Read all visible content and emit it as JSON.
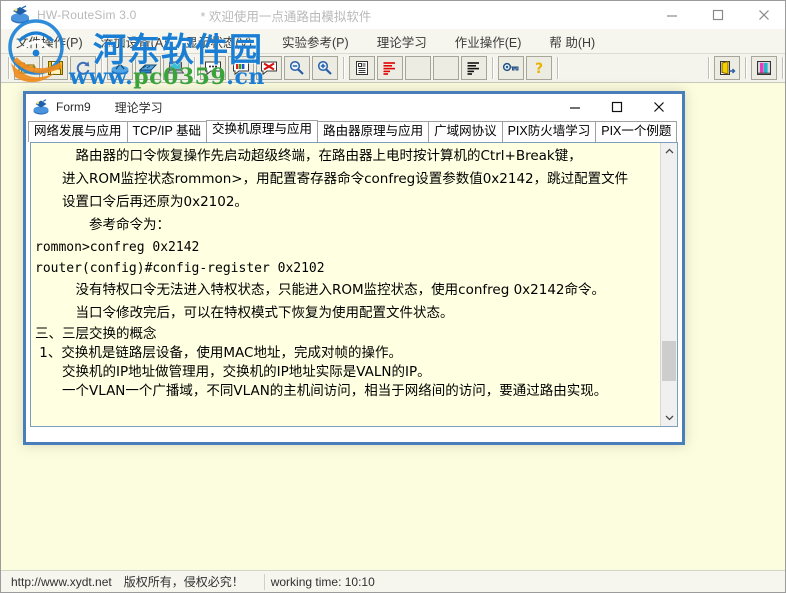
{
  "window": {
    "app_name": "HW-RouteSim 3.0",
    "title_note": "* 欢迎使用一点通路由模拟软件",
    "app_icon": "router-app-icon",
    "minimize": "minimize-icon",
    "maximize": "maximize-icon",
    "close": "close-icon"
  },
  "menubar": {
    "items": [
      {
        "label": "文件操作(P)",
        "name": "menu-file"
      },
      {
        "label": "添加设备(A)",
        "name": "menu-add-device"
      },
      {
        "label": "显示状态(V)",
        "name": "menu-show-status"
      },
      {
        "label": "实验参考(P)",
        "name": "menu-experiment-reference"
      },
      {
        "label": "理论学习",
        "name": "menu-theory-study"
      },
      {
        "label": "作业操作(E)",
        "name": "menu-homework"
      },
      {
        "label": "帮 助(H)",
        "name": "menu-help"
      }
    ]
  },
  "toolbar": {
    "buttons": [
      {
        "icon": "open-folder-icon",
        "name": "toolbar-open"
      },
      {
        "icon": "save-floppy-icon",
        "name": "toolbar-save"
      },
      {
        "icon": "refresh-icon",
        "name": "toolbar-refresh"
      },
      {
        "icon": "router-icon",
        "name": "toolbar-add-router"
      },
      {
        "icon": "switch-icon",
        "name": "toolbar-add-switch"
      },
      {
        "icon": "pc-icon",
        "name": "toolbar-add-pc"
      },
      {
        "icon": "console-balloon-icon",
        "name": "toolbar-console"
      },
      {
        "icon": "color-balloon-icon",
        "name": "toolbar-color-console"
      },
      {
        "icon": "close-balloon-icon",
        "name": "toolbar-close-console"
      },
      {
        "icon": "zoom-out-icon",
        "name": "toolbar-zoom-out"
      },
      {
        "icon": "zoom-in-icon",
        "name": "toolbar-zoom-in"
      },
      {
        "icon": "document-icon",
        "name": "toolbar-document"
      },
      {
        "icon": "red-lines-icon",
        "name": "toolbar-red-lines"
      },
      {
        "icon": "blank-icon",
        "name": "toolbar-blank-1"
      },
      {
        "icon": "blank-icon",
        "name": "toolbar-blank-2"
      },
      {
        "icon": "black-lines-icon",
        "name": "toolbar-black-lines"
      },
      {
        "icon": "key-icon",
        "name": "toolbar-key"
      },
      {
        "icon": "help-question-icon",
        "name": "toolbar-help"
      },
      {
        "icon": "exit-door-icon",
        "name": "toolbar-exit"
      },
      {
        "icon": "cabinet-icon",
        "name": "toolbar-cabinet"
      }
    ]
  },
  "mdi": {
    "form_name": "Form9",
    "form_subtitle": "理论学习",
    "icon": "form-icon",
    "minimize": "minimize-icon",
    "maximize": "maximize-icon",
    "close": "close-icon",
    "tabs": [
      {
        "label": "网络发展与应用",
        "name": "tab-network-development",
        "active": false
      },
      {
        "label": "TCP/IP 基础",
        "name": "tab-tcpip-basics",
        "active": false
      },
      {
        "label": "交换机原理与应用",
        "name": "tab-switch-principles",
        "active": true
      },
      {
        "label": "路由器原理与应用",
        "name": "tab-router-principles",
        "active": false
      },
      {
        "label": "广域网协议",
        "name": "tab-wan-protocols",
        "active": false
      },
      {
        "label": "PIX防火墙学习",
        "name": "tab-pix-firewall",
        "active": false
      },
      {
        "label": "PIX一个例题",
        "name": "tab-pix-example",
        "active": false
      }
    ],
    "content_lines": [
      {
        "text": "　　　路由器的口令恢复操作先启动超级终端，在路由器上电时按计算机的Ctrl+Break键，",
        "style": "body"
      },
      {
        "text": "　　进入ROM监控状态rommon>，用配置寄存器命令confreg设置参数值0x2142，跳过配置文件",
        "style": "body"
      },
      {
        "text": "　　设置口令后再还原为0x2102。",
        "style": "body"
      },
      {
        "text": "　　　　参考命令为：",
        "style": "body"
      },
      {
        "text": "rommon>confreg 0x2142",
        "style": "mono"
      },
      {
        "text": "router(config)#config-register 0x2102",
        "style": "mono"
      },
      {
        "text": "　　　没有特权口令无法进入特权状态，只能进入ROM监控状态，使用confreg 0x2142命令。",
        "style": "body"
      },
      {
        "text": "　　　当口令修改完后，可以在特权模式下恢复为使用配置文件状态。",
        "style": "body"
      },
      {
        "text": "三、三层交换的概念",
        "style": "tight"
      },
      {
        "text": " 1、交换机是链路层设备，使用MAC地址，完成对帧的操作。",
        "style": "tight"
      },
      {
        "text": "　　交换机的IP地址做管理用，交换机的IP地址实际是VALN的IP。",
        "style": "tight"
      },
      {
        "text": "　　一个VLAN一个广播域，不同VLAN的主机间访问，相当于网络间的访问，要通过路由实现。",
        "style": "tight"
      }
    ],
    "scrollbar": {
      "up_arrow": "chevron-up-icon",
      "down_arrow": "chevron-down-icon",
      "thumb": "scroll-thumb"
    }
  },
  "statusbar": {
    "cells": [
      {
        "label": "http://www.xydt.net　版权所有，侵权必究！",
        "name": "status-copyright"
      },
      {
        "label": "working time: 10:10",
        "name": "status-working-time"
      }
    ]
  },
  "watermark": {
    "cn_text": "河东软件园",
    "url_prefix": "www.",
    "url_mid": "pc0359",
    "url_suffix": ".cn",
    "logo": "hedong-logo-icon"
  },
  "colors": {
    "workspace_bg": "#fcfcdf",
    "text_bg": "#ffffe1",
    "mdi_border": "#4a7ebb",
    "watermark_blue": "#1a7fd4",
    "watermark_green": "#3aa33a",
    "toolbar_bg": "#f4f4ec"
  }
}
